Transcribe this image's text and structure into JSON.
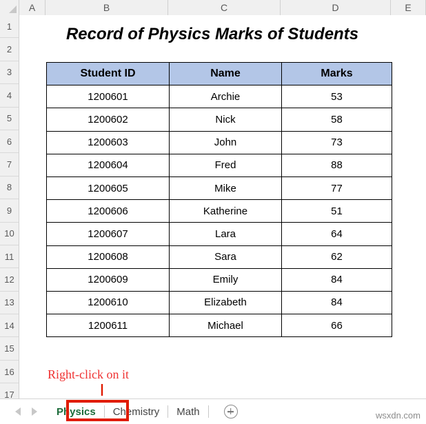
{
  "app": {
    "type": "spreadsheet",
    "watermark": "wsxdn.com"
  },
  "grid": {
    "column_headers": [
      "A",
      "B",
      "C",
      "D",
      "E"
    ],
    "row_headers": [
      "1",
      "2",
      "3",
      "4",
      "5",
      "6",
      "7",
      "8",
      "9",
      "10",
      "11",
      "12",
      "13",
      "14",
      "15",
      "16",
      "17"
    ],
    "select_all_icon": "select-all-corner"
  },
  "sheet": {
    "title": "Record of Physics Marks of Students",
    "table": {
      "headers": [
        "Student ID",
        "Name",
        "Marks"
      ],
      "header_fill": "#b3c6e7",
      "rows": [
        [
          "1200601",
          "Archie",
          "53"
        ],
        [
          "1200602",
          "Nick",
          "58"
        ],
        [
          "1200603",
          "John",
          "73"
        ],
        [
          "1200604",
          "Fred",
          "88"
        ],
        [
          "1200605",
          "Mike",
          "77"
        ],
        [
          "1200606",
          "Katherine",
          "51"
        ],
        [
          "1200607",
          "Lara",
          "64"
        ],
        [
          "1200608",
          "Sara",
          "62"
        ],
        [
          "1200609",
          "Emily",
          "84"
        ],
        [
          "1200610",
          "Elizabeth",
          "84"
        ],
        [
          "1200611",
          "Michael",
          "66"
        ]
      ]
    }
  },
  "annotation": {
    "text": "Right-click on it",
    "color": "#ef3232",
    "arrow_icon": "down-arrow-icon",
    "highlight_color": "#e01b00"
  },
  "tab_bar": {
    "nav_prev_icon": "nav-prev-icon",
    "nav_next_icon": "nav-next-icon",
    "tabs": [
      {
        "label": "Physics",
        "active": true
      },
      {
        "label": "Chemistry",
        "active": false
      },
      {
        "label": "Math",
        "active": false
      }
    ],
    "add_sheet_icon": "add-sheet-icon"
  }
}
